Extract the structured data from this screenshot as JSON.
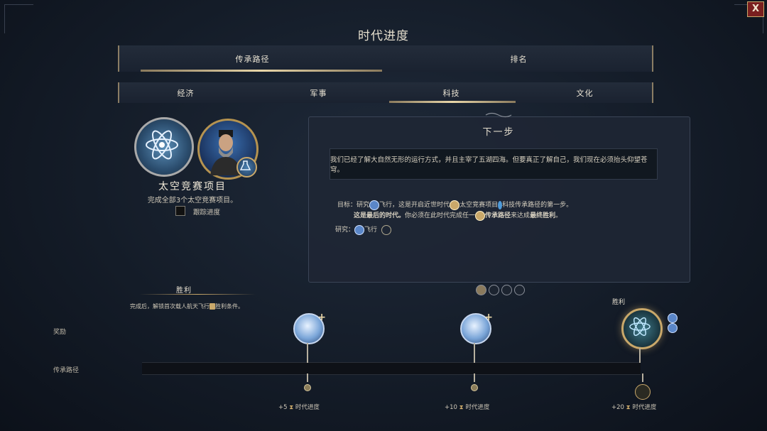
{
  "window": {
    "close_label": "X",
    "title": "时代进度"
  },
  "top_tabs": [
    {
      "label": "传承路径",
      "active": true
    },
    {
      "label": "排名",
      "active": false
    }
  ],
  "sub_tabs": [
    {
      "label": "经济",
      "active": false
    },
    {
      "label": "军事",
      "active": false
    },
    {
      "label": "科技",
      "active": true
    },
    {
      "label": "文化",
      "active": false
    }
  ],
  "project": {
    "title": "太空竞赛项目",
    "description": "完成全部3个太空竞赛项目。",
    "track_label": "跟踪进度",
    "medal_icon": "atom-laurel-icon",
    "leader_icon": "leader-portrait-icon",
    "badge_icon": "flask-icon"
  },
  "next_step": {
    "title": "下一步",
    "quote": "我们已经了解大自然无形的运行方式，并且主宰了五湖四海。但要真正了解自己，我们现在必须抬头仰望苍穹。",
    "goal_prefix": "目标：",
    "goal_line1_a": "研究",
    "goal_tech": "飞行",
    "goal_line1_b": "，这是开启近世时代",
    "goal_project": "太空竞赛项目",
    "goal_line1_c": "科技传承路径的第一步。",
    "goal_line2_a": "这是最后的时代。",
    "goal_line2_b": "你必须在此时代完成任一",
    "goal_legacy": "传承路径",
    "goal_line2_c": "来达成",
    "goal_victory": "最终胜利",
    "goal_line2_d": "。",
    "research_label": "研究：",
    "research_tech": "飞行"
  },
  "pagination": {
    "count": 4,
    "active": 0
  },
  "victory": {
    "header": "胜利",
    "description_a": "完成后，解锁首次载人航天飞行",
    "description_b": "胜利条件。"
  },
  "rows": {
    "rewards": "奖励",
    "legacy": "传承路径"
  },
  "milestones": [
    {
      "label_value": "+5",
      "label_text": "时代进度"
    },
    {
      "label_value": "+10",
      "label_text": "时代进度"
    },
    {
      "label_value": "+20",
      "label_text": "时代进度"
    }
  ],
  "final_reward": {
    "label": "胜利"
  },
  "colors": {
    "accent_gold": "#c9a86a",
    "panel": "#1e2634",
    "close_red": "#7a1f1f"
  }
}
